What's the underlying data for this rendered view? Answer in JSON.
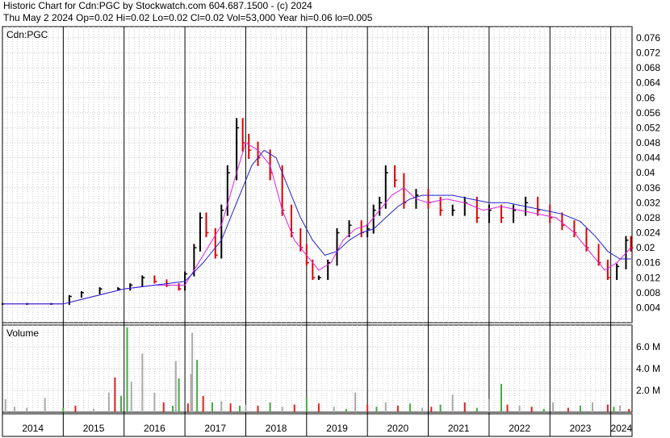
{
  "header": {
    "title_line": "Historic Chart for Cdn:PGC by Stockwatch.com 604.687.1500 - (c) 2024",
    "quote_line": "Thu May  2 2024  Op=0.02  Hi=0.02  Lo=0.02  Cl=0.02  Vol=53,000  Year hi=0.06  lo=0.005"
  },
  "colors": {
    "up_bar": "#000000",
    "down_bar": "#dd0000",
    "ma_short": "#dd22dd",
    "ma_long": "#2222cc",
    "grid": "#c8c8c8",
    "vol_up": "#44aa44",
    "vol_down": "#dd2222",
    "vol_flat": "#aaaaaa"
  },
  "chart_data": [
    {
      "type": "line",
      "panel": "price",
      "label": "Cdn:PGC",
      "y_ticks": [
        "0.076",
        "0.072",
        "0.068",
        "0.064",
        "0.06",
        "0.056",
        "0.052",
        "0.048",
        "0.044",
        "0.04",
        "0.036",
        "0.032",
        "0.028",
        "0.024",
        "0.02",
        "0.016",
        "0.012",
        "0.008",
        "0.004"
      ],
      "ylim": [
        0,
        0.079
      ],
      "x_labels": [
        "2014",
        "2015",
        "2016",
        "2017",
        "2018",
        "2019",
        "2020",
        "2021",
        "2022",
        "2023",
        "2024"
      ],
      "xlim": [
        2014.0,
        2024.35
      ],
      "grid": true,
      "series": [
        {
          "key": "close",
          "x": [
            2014.0,
            2014.4,
            2014.8,
            2015.1,
            2015.3,
            2015.6,
            2015.9,
            2016.1,
            2016.3,
            2016.5,
            2016.7,
            2016.9,
            2017.0,
            2017.15,
            2017.25,
            2017.35,
            2017.5,
            2017.6,
            2017.7,
            2017.85,
            2017.95,
            2018.05,
            2018.2,
            2018.4,
            2018.6,
            2018.75,
            2018.9,
            2019.0,
            2019.1,
            2019.2,
            2019.35,
            2019.5,
            2019.7,
            2019.9,
            2020.0,
            2020.1,
            2020.2,
            2020.3,
            2020.45,
            2020.6,
            2020.8,
            2021.0,
            2021.2,
            2021.4,
            2021.6,
            2021.8,
            2022.0,
            2022.2,
            2022.4,
            2022.6,
            2022.8,
            2023.0,
            2023.2,
            2023.4,
            2023.6,
            2023.8,
            2023.95,
            2024.1,
            2024.25,
            2024.33
          ],
          "values": [
            0.005,
            0.005,
            0.005,
            0.007,
            0.008,
            0.009,
            0.009,
            0.01,
            0.012,
            0.011,
            0.01,
            0.009,
            0.013,
            0.02,
            0.028,
            0.024,
            0.018,
            0.03,
            0.04,
            0.052,
            0.048,
            0.046,
            0.044,
            0.04,
            0.03,
            0.024,
            0.02,
            0.016,
            0.012,
            0.012,
            0.016,
            0.024,
            0.026,
            0.024,
            0.025,
            0.03,
            0.032,
            0.04,
            0.038,
            0.032,
            0.034,
            0.032,
            0.03,
            0.03,
            0.032,
            0.028,
            0.03,
            0.028,
            0.03,
            0.032,
            0.03,
            0.028,
            0.026,
            0.024,
            0.02,
            0.016,
            0.012,
            0.015,
            0.022,
            0.02
          ]
        },
        {
          "key": "ma_short",
          "x": [
            2014.0,
            2014.5,
            2015.0,
            2015.5,
            2016.0,
            2016.5,
            2017.0,
            2017.3,
            2017.6,
            2017.85,
            2018.0,
            2018.2,
            2018.4,
            2018.6,
            2018.8,
            2019.0,
            2019.2,
            2019.4,
            2019.6,
            2019.8,
            2020.0,
            2020.2,
            2020.4,
            2020.6,
            2020.8,
            2021.0,
            2021.3,
            2021.6,
            2021.9,
            2022.2,
            2022.5,
            2022.8,
            2023.1,
            2023.4,
            2023.7,
            2023.9,
            2024.1,
            2024.33
          ],
          "values": [
            0.005,
            0.005,
            0.005,
            0.007,
            0.009,
            0.01,
            0.01,
            0.018,
            0.026,
            0.04,
            0.048,
            0.046,
            0.042,
            0.03,
            0.022,
            0.018,
            0.014,
            0.016,
            0.022,
            0.025,
            0.026,
            0.03,
            0.034,
            0.036,
            0.033,
            0.032,
            0.033,
            0.032,
            0.03,
            0.031,
            0.03,
            0.029,
            0.028,
            0.024,
            0.018,
            0.014,
            0.016,
            0.02
          ]
        },
        {
          "key": "ma_long",
          "x": [
            2014.0,
            2014.5,
            2015.0,
            2015.5,
            2016.0,
            2016.5,
            2017.0,
            2017.3,
            2017.6,
            2017.85,
            2018.1,
            2018.3,
            2018.5,
            2018.7,
            2018.9,
            2019.1,
            2019.3,
            2019.5,
            2019.7,
            2019.9,
            2020.1,
            2020.3,
            2020.5,
            2020.7,
            2020.9,
            2021.1,
            2021.4,
            2021.7,
            2022.0,
            2022.3,
            2022.6,
            2022.9,
            2023.2,
            2023.5,
            2023.75,
            2023.95,
            2024.15,
            2024.33
          ],
          "values": [
            0.005,
            0.005,
            0.005,
            0.007,
            0.009,
            0.01,
            0.011,
            0.016,
            0.022,
            0.032,
            0.042,
            0.046,
            0.044,
            0.036,
            0.028,
            0.022,
            0.018,
            0.019,
            0.022,
            0.024,
            0.025,
            0.028,
            0.031,
            0.033,
            0.034,
            0.034,
            0.034,
            0.033,
            0.032,
            0.032,
            0.031,
            0.03,
            0.029,
            0.027,
            0.023,
            0.019,
            0.017,
            0.017
          ]
        }
      ]
    },
    {
      "type": "bar",
      "panel": "volume",
      "label": "Volume",
      "y_ticks": [
        "6.0 M",
        "4.0 M",
        "2.0 M"
      ],
      "ylim": [
        0,
        8.0
      ],
      "x": [
        2014.05,
        2014.2,
        2014.4,
        2014.7,
        2015.0,
        2015.2,
        2015.5,
        2015.75,
        2015.85,
        2015.95,
        2016.05,
        2016.12,
        2016.3,
        2016.5,
        2016.65,
        2016.8,
        2016.85,
        2016.9,
        2017.05,
        2017.1,
        2017.12,
        2017.2,
        2017.3,
        2017.45,
        2017.6,
        2017.75,
        2017.9,
        2018.0,
        2018.2,
        2018.4,
        2018.6,
        2018.8,
        2019.0,
        2019.2,
        2019.45,
        2019.65,
        2019.8,
        2020.0,
        2020.15,
        2020.3,
        2020.5,
        2020.7,
        2020.9,
        2021.05,
        2021.2,
        2021.4,
        2021.6,
        2021.8,
        2022.0,
        2022.2,
        2022.3,
        2022.5,
        2022.7,
        2022.9,
        2023.05,
        2023.3,
        2023.5,
        2023.7,
        2023.95,
        2024.05,
        2024.15,
        2024.3
      ],
      "values": [
        1.2,
        0.5,
        0.4,
        1.3,
        0.4,
        0.6,
        0.3,
        1.8,
        3.2,
        1.5,
        7.8,
        2.8,
        5.4,
        1.8,
        0.9,
        0.6,
        4.7,
        3.1,
        0.8,
        3.5,
        7.3,
        4.8,
        1.5,
        0.9,
        1.0,
        0.8,
        0.6,
        0.7,
        0.6,
        0.9,
        0.5,
        0.7,
        1.4,
        0.8,
        0.5,
        0.3,
        1.8,
        0.7,
        0.5,
        0.9,
        0.6,
        0.8,
        0.4,
        0.5,
        0.7,
        1.6,
        0.9,
        0.4,
        1.2,
        2.6,
        0.7,
        0.6,
        0.5,
        0.3,
        0.9,
        0.4,
        0.6,
        0.9,
        0.7,
        0.5,
        0.6,
        0.3
      ],
      "direction": [
        "flat",
        "flat",
        "flat",
        "flat",
        "up",
        "down",
        "flat",
        "flat",
        "down",
        "up",
        "up",
        "flat",
        "flat",
        "flat",
        "down",
        "up",
        "flat",
        "up",
        "down",
        "flat",
        "flat",
        "up",
        "down",
        "up",
        "flat",
        "down",
        "up",
        "flat",
        "down",
        "up",
        "flat",
        "down",
        "up",
        "down",
        "flat",
        "up",
        "flat",
        "down",
        "up",
        "flat",
        "down",
        "up",
        "flat",
        "down",
        "up",
        "flat",
        "down",
        "up",
        "flat",
        "up",
        "down",
        "flat",
        "down",
        "up",
        "flat",
        "down",
        "up",
        "flat",
        "down",
        "up",
        "flat",
        "down"
      ]
    }
  ]
}
